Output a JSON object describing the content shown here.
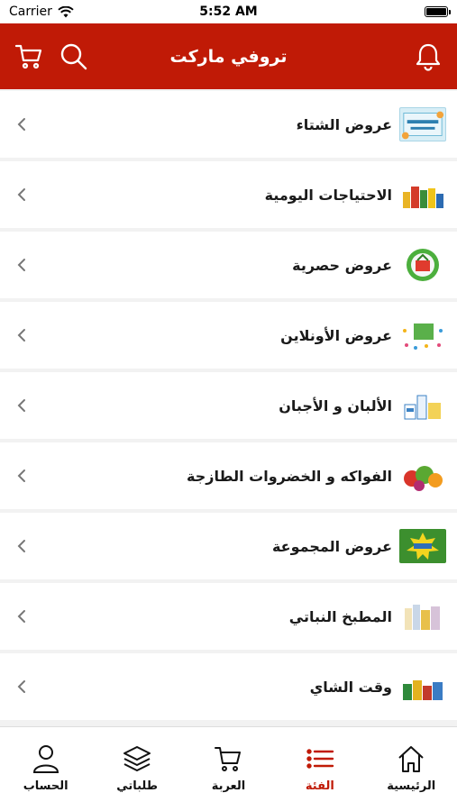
{
  "status_bar": {
    "carrier": "Carrier",
    "time": "5:52 AM"
  },
  "header": {
    "title": "تروفي ماركت",
    "accent_color": "#c01a06"
  },
  "categories": [
    {
      "label": "عروض الشتاء",
      "thumb_icon": "winter-offers-thumb"
    },
    {
      "label": "الاحتياجات اليومية",
      "thumb_icon": "daily-needs-thumb"
    },
    {
      "label": "عروض حصرية",
      "thumb_icon": "exclusive-offers-thumb"
    },
    {
      "label": "عروض الأونلاين",
      "thumb_icon": "online-offers-thumb"
    },
    {
      "label": "الألبان و الأجبان",
      "thumb_icon": "dairy-cheese-thumb"
    },
    {
      "label": "الفواكه و الخضروات الطازجة",
      "thumb_icon": "fruits-vegetables-thumb"
    },
    {
      "label": "عروض المجموعة",
      "thumb_icon": "group-offers-thumb"
    },
    {
      "label": "المطبخ النباتي",
      "thumb_icon": "vegetarian-kitchen-thumb"
    },
    {
      "label": "وقت الشاي",
      "thumb_icon": "tea-time-thumb"
    }
  ],
  "tabbar": {
    "items": [
      {
        "label": "الحساب",
        "icon": "user-icon"
      },
      {
        "label": "طلباتي",
        "icon": "layers-icon"
      },
      {
        "label": "العربة",
        "icon": "cart-icon"
      },
      {
        "label": "الفئة",
        "icon": "list-icon",
        "active": true
      },
      {
        "label": "الرئيسية",
        "icon": "home-icon"
      }
    ]
  }
}
